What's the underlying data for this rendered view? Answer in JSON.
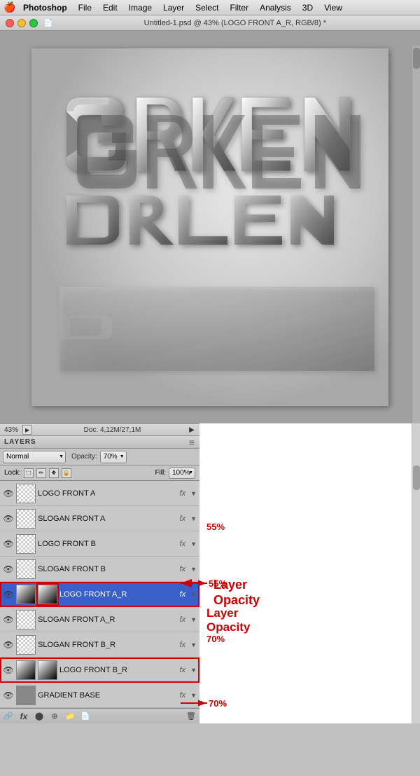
{
  "menubar": {
    "apple": "🍎",
    "items": [
      "Photoshop",
      "File",
      "Edit",
      "Image",
      "Layer",
      "Select",
      "Filter",
      "Analysis",
      "3D",
      "View"
    ]
  },
  "titlebar": {
    "title": "Untitled-1.psd @ 43% (LOGO FRONT A_R, RGB/8) *"
  },
  "statusbar": {
    "zoom": "43%",
    "doc_info": "Doc: 4,12M/27,1M"
  },
  "layers_panel": {
    "title": "LAYERS",
    "blend_mode": "Normal",
    "opacity_label": "Opacity:",
    "opacity_value": "70%",
    "lock_label": "Lock:",
    "fill_label": "Fill:",
    "fill_value": "100%",
    "layers": [
      {
        "name": "LOGO FRONT A",
        "has_eye": true,
        "fx": true,
        "selected": false,
        "highlighted": false,
        "thumb_type": "checker"
      },
      {
        "name": "SLOGAN FRONT A",
        "has_eye": true,
        "fx": true,
        "selected": false,
        "highlighted": false,
        "thumb_type": "checker"
      },
      {
        "name": "LOGO FRONT B",
        "has_eye": true,
        "fx": true,
        "selected": false,
        "highlighted": false,
        "thumb_type": "checker"
      },
      {
        "name": "SLOGAN FRONT B",
        "has_eye": true,
        "fx": true,
        "selected": false,
        "highlighted": false,
        "thumb_type": "checker"
      },
      {
        "name": "LOGO FRONT A_R",
        "has_eye": true,
        "fx": true,
        "selected": true,
        "highlighted": true,
        "thumb_type": "gradient_white"
      },
      {
        "name": "SLOGAN FRONT A_R",
        "has_eye": true,
        "fx": true,
        "selected": false,
        "highlighted": false,
        "thumb_type": "checker"
      },
      {
        "name": "SLOGAN FRONT B_R",
        "has_eye": true,
        "fx": true,
        "selected": false,
        "highlighted": false,
        "thumb_type": "checker"
      },
      {
        "name": "LOGO FRONT B_R",
        "has_eye": true,
        "fx": true,
        "selected": false,
        "highlighted": true,
        "thumb_type": "gradient_white"
      },
      {
        "name": "GRADIENT BASE",
        "has_eye": true,
        "fx": true,
        "selected": false,
        "highlighted": false,
        "thumb_type": "plain"
      }
    ]
  },
  "annotations": {
    "arrow1_label": "55%",
    "arrow2_label": "70%",
    "layer_opacity_text": "Layer\nOpacity"
  },
  "footer": {
    "icons": [
      "link",
      "fx",
      "circle",
      "trash",
      "folder"
    ]
  }
}
